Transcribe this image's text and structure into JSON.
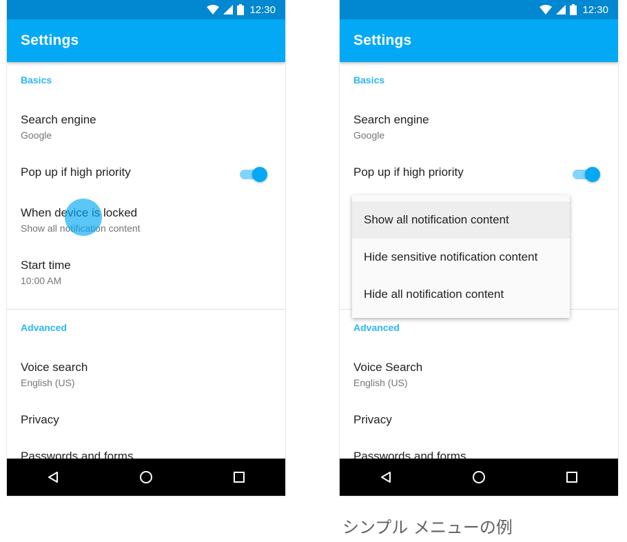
{
  "status": {
    "time": "12:30"
  },
  "appbar_title": "Settings",
  "left": {
    "basics": "Basics",
    "search_engine": {
      "label": "Search engine",
      "value": "Google"
    },
    "popup": {
      "label": "Pop up if high priority",
      "enabled": true
    },
    "locked": {
      "label": "When device is locked",
      "value": "Show all notification content"
    },
    "start_time": {
      "label": "Start time",
      "value": "10:00 AM"
    },
    "advanced": "Advanced",
    "voice": {
      "label": "Voice search",
      "value": "English (US)"
    },
    "privacy": "Privacy",
    "passwords": "Passwords and forms"
  },
  "right": {
    "basics": "Basics",
    "search_engine": {
      "label": "Search engine",
      "value": "Google"
    },
    "popup": {
      "label": "Pop up if high priority",
      "enabled": true
    },
    "menu": {
      "items": [
        "Show all notification content",
        "Hide sensitive notification content",
        "Hide all notification content"
      ],
      "selected": "Show all notification content"
    },
    "advanced": "Advanced",
    "voice": {
      "label": "Voice Search",
      "value": "English (US)"
    },
    "privacy": "Privacy",
    "passwords": "Passwords and forms"
  },
  "caption": "シンプル メニューの例",
  "icons": [
    "wifi-icon",
    "cell-signal-icon",
    "battery-icon",
    "back-icon",
    "home-icon",
    "recents-icon"
  ],
  "colors": {
    "primary": "#03a9f4",
    "primary_dark": "#0288d1",
    "accent": "#29b6f6"
  }
}
